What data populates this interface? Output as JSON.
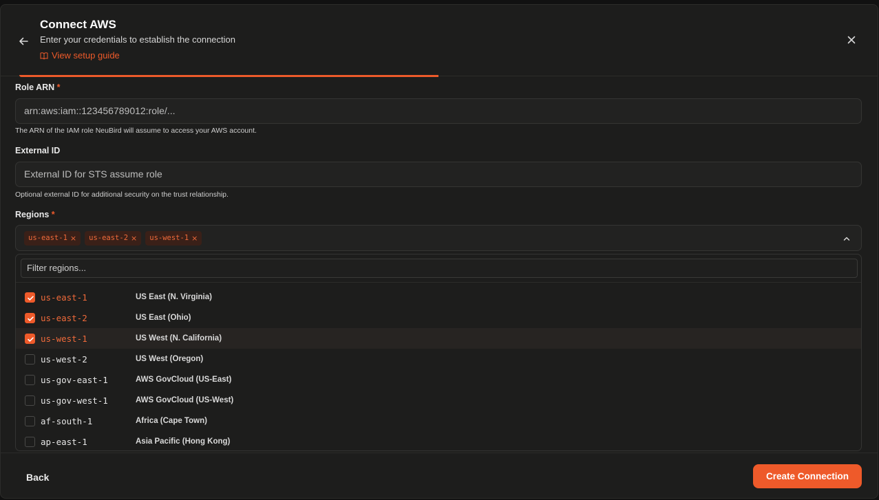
{
  "header": {
    "title": "Connect AWS",
    "subtitle": "Enter your credentials to establish the connection",
    "guide_link": "View setup guide"
  },
  "progress": {
    "fraction": 0.5
  },
  "role_arn": {
    "label": "Role ARN",
    "required_mark": "*",
    "value": "arn:aws:iam::123456789012:role/...",
    "hint": "The ARN of the IAM role NeuBird will assume to access your AWS account."
  },
  "external_id": {
    "label": "External ID",
    "placeholder": "External ID for STS assume role",
    "hint": "Optional external ID for additional security on the trust relationship."
  },
  "regions": {
    "label": "Regions",
    "required_mark": "*",
    "chip_remove": "×",
    "selected": [
      "us-east-1",
      "us-east-2",
      "us-west-1"
    ],
    "filter_placeholder": "Filter regions...",
    "options": [
      {
        "code": "us-east-1",
        "name": "US East (N. Virginia)",
        "checked": true
      },
      {
        "code": "us-east-2",
        "name": "US East (Ohio)",
        "checked": true
      },
      {
        "code": "us-west-1",
        "name": "US West (N. California)",
        "checked": true
      },
      {
        "code": "us-west-2",
        "name": "US West (Oregon)",
        "checked": false
      },
      {
        "code": "us-gov-east-1",
        "name": "AWS GovCloud (US-East)",
        "checked": false
      },
      {
        "code": "us-gov-west-1",
        "name": "AWS GovCloud (US-West)",
        "checked": false
      },
      {
        "code": "af-south-1",
        "name": "Africa (Cape Town)",
        "checked": false
      },
      {
        "code": "ap-east-1",
        "name": "Asia Pacific (Hong Kong)",
        "checked": false
      }
    ]
  },
  "footer": {
    "back_label": "Back",
    "create_label": "Create Connection"
  },
  "colors": {
    "accent": "#ee5a2a",
    "background": "#1d1d1c"
  }
}
